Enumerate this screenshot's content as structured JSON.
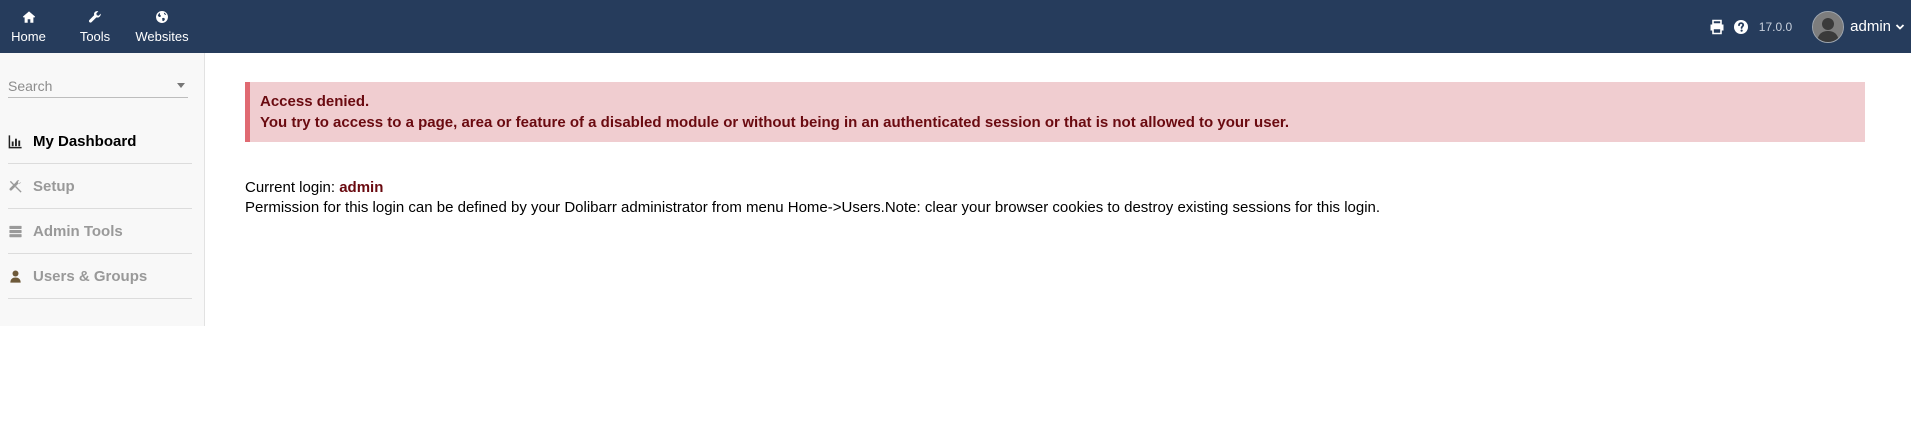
{
  "topbar": {
    "nav": [
      {
        "label": "Home",
        "icon": "home-icon"
      },
      {
        "label": "Tools",
        "icon": "wrench-icon"
      },
      {
        "label": "Websites",
        "icon": "globe-icon"
      }
    ],
    "version": "17.0.0",
    "user": {
      "name": "admin",
      "avatar": "avatar-icon"
    },
    "icons": {
      "print": "printer-icon",
      "help": "help-icon",
      "user_menu": "chevron-down-icon"
    }
  },
  "sidebar": {
    "search": {
      "placeholder": "Search"
    },
    "items": [
      {
        "label": "My Dashboard",
        "icon": "bar-chart-icon",
        "active": true
      },
      {
        "label": "Setup",
        "icon": "tools-icon",
        "active": false
      },
      {
        "label": "Admin Tools",
        "icon": "server-icon",
        "active": false
      },
      {
        "label": "Users & Groups",
        "icon": "user-icon",
        "active": false
      }
    ]
  },
  "main": {
    "alert": {
      "title": "Access denied.",
      "message": "You try to access to a page, area or feature of a disabled module or without being in an authenticated session or that is not allowed to your user."
    },
    "current_login_label": "Current login:",
    "current_login_value": "admin",
    "permission_note": "Permission for this login can be defined by your Dolibarr administrator from menu Home->Users.Note: clear your browser cookies to destroy existing sessions for this login."
  },
  "colors": {
    "topbar_bg": "#263c5c",
    "alert_bg": "#f0cdd0",
    "alert_border": "#e06a72",
    "alert_text": "#6a0a10"
  }
}
